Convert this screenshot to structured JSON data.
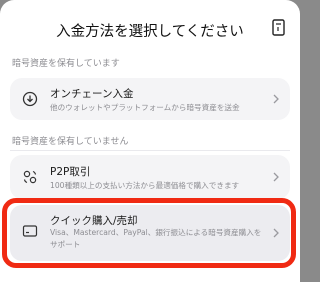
{
  "header": {
    "title": "入金方法を選択してください"
  },
  "sections": [
    {
      "label": "暗号資産を保有しています",
      "items": [
        {
          "title": "オンチェーン入金",
          "desc": "他のウォレットやプラットフォームから暗号資産を送金"
        }
      ]
    },
    {
      "label": "暗号資産を保有していません",
      "items": [
        {
          "title": "P2P取引",
          "desc": "100種類以上の支払い方法から最適価格で購入できます"
        },
        {
          "title": "クイック購入/売却",
          "desc": "Visa、Mastercard、PayPal、銀行振込による暗号資産購入をサポート"
        }
      ]
    }
  ],
  "icons": {
    "close": "book-exit-icon",
    "onchain": "download-circle-icon",
    "p2p": "p2p-exchange-icon",
    "quick": "credit-card-icon",
    "chevron": "chevron-right-icon"
  },
  "colors": {
    "highlight": "#f02a13",
    "card_bg": "#f4f4f6",
    "muted_text": "#8d8d92"
  }
}
